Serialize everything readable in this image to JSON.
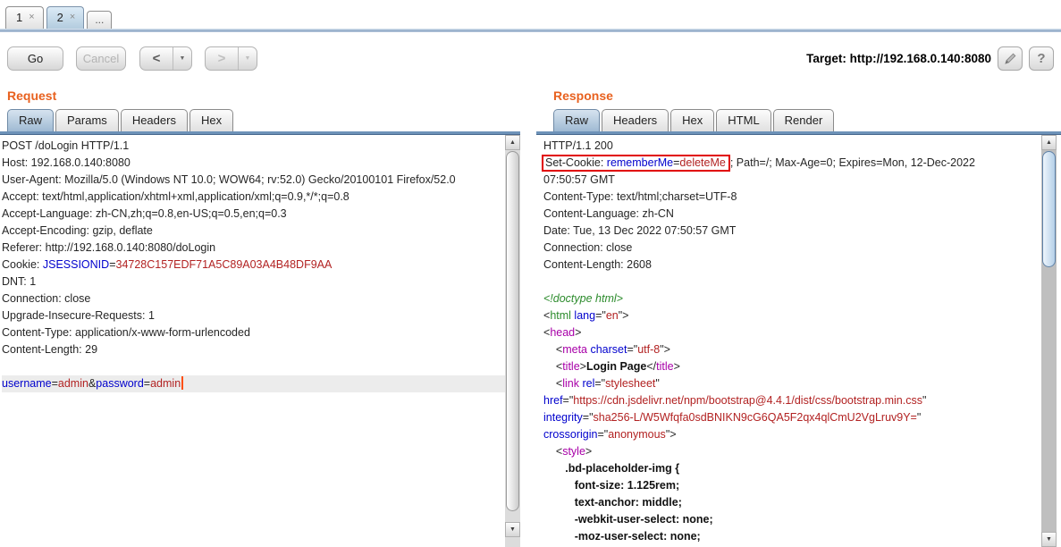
{
  "session_tabs": [
    {
      "label": "1",
      "close": "×",
      "selected": false,
      "mini": false
    },
    {
      "label": "2",
      "close": "×",
      "selected": true,
      "mini": false
    },
    {
      "label": "...",
      "close": "",
      "selected": false,
      "mini": true
    }
  ],
  "toolbar": {
    "go": "Go",
    "cancel": "Cancel",
    "back_icon": "<",
    "forward_icon": ">",
    "dropdown_icon": "▼",
    "target_label": "Target:",
    "target_url": "http://192.168.0.140:8080",
    "help_icon": "?"
  },
  "scrollbar": {
    "up_icon": "▲",
    "down_icon": "▼"
  },
  "colors": {
    "accent_orange": "#e8611f",
    "syntax_key_blue": "#0101cd",
    "syntax_value_red": "#b22222",
    "syntax_tag_magenta": "#a800a8",
    "syntax_green": "#2c8b2c",
    "highlight_box_red": "#e10000",
    "selected_tab_blue": "#b3ccdf"
  },
  "request": {
    "title": "Request",
    "tabs": [
      {
        "label": "Raw",
        "selected": true
      },
      {
        "label": "Params",
        "selected": false
      },
      {
        "label": "Headers",
        "selected": false
      },
      {
        "label": "Hex",
        "selected": false
      }
    ],
    "lines": [
      {
        "parts": [
          {
            "t": "POST /doLogin HTTP/1.1"
          }
        ]
      },
      {
        "parts": [
          {
            "t": "Host: 192.168.0.140:8080"
          }
        ]
      },
      {
        "parts": [
          {
            "t": "User-Agent: Mozilla/5.0 (Windows NT 10.0; WOW64; rv:52.0) Gecko/20100101 Firefox/52.0"
          }
        ]
      },
      {
        "parts": [
          {
            "t": "Accept: text/html,application/xhtml+xml,application/xml;q=0.9,*/*;q=0.8"
          }
        ]
      },
      {
        "parts": [
          {
            "t": "Accept-Language: zh-CN,zh;q=0.8,en-US;q=0.5,en;q=0.3"
          }
        ]
      },
      {
        "parts": [
          {
            "t": "Accept-Encoding: gzip, deflate"
          }
        ]
      },
      {
        "parts": [
          {
            "t": "Referer: http://192.168.0.140:8080/doLogin"
          }
        ]
      },
      {
        "parts": [
          {
            "t": "Cookie: "
          },
          {
            "t": "JSESSIONID",
            "c": "k"
          },
          {
            "t": "="
          },
          {
            "t": "34728C157EDF71A5C89A03A4B48DF9AA",
            "c": "v"
          }
        ]
      },
      {
        "parts": [
          {
            "t": "DNT: 1"
          }
        ]
      },
      {
        "parts": [
          {
            "t": "Connection: close"
          }
        ]
      },
      {
        "parts": [
          {
            "t": "Upgrade-Insecure-Requests: 1"
          }
        ]
      },
      {
        "parts": [
          {
            "t": "Content-Type: application/x-www-form-urlencoded"
          }
        ]
      },
      {
        "parts": [
          {
            "t": "Content-Length: 29"
          }
        ]
      },
      {
        "parts": []
      },
      {
        "hl": true,
        "cursor": true,
        "parts": [
          {
            "t": "username",
            "c": "k"
          },
          {
            "t": "="
          },
          {
            "t": "admin",
            "c": "v"
          },
          {
            "t": "&"
          },
          {
            "t": "password",
            "c": "k"
          },
          {
            "t": "="
          },
          {
            "t": "admin",
            "c": "v"
          }
        ]
      }
    ]
  },
  "response": {
    "title": "Response",
    "tabs": [
      {
        "label": "Raw",
        "selected": true
      },
      {
        "label": "Headers",
        "selected": false
      },
      {
        "label": "Hex",
        "selected": false
      },
      {
        "label": "HTML",
        "selected": false
      },
      {
        "label": "Render",
        "selected": false
      }
    ],
    "lines": [
      {
        "parts": [
          {
            "t": "HTTP/1.1 200"
          }
        ]
      },
      {
        "parts": [
          {
            "t": "Set-Cookie: ",
            "x": 1
          },
          {
            "t": "rememberMe",
            "c": "k",
            "x": 1
          },
          {
            "t": "=",
            "x": 1
          },
          {
            "t": "deleteMe",
            "c": "v",
            "x": 1
          },
          {
            "t": "; Path=/; Max-Age=0; Expires=Mon, 12-Dec-2022"
          }
        ]
      },
      {
        "parts": [
          {
            "t": "07:50:57 GMT"
          }
        ]
      },
      {
        "parts": [
          {
            "t": "Content-Type: text/html;charset=UTF-8"
          }
        ]
      },
      {
        "parts": [
          {
            "t": "Content-Language: zh-CN"
          }
        ]
      },
      {
        "parts": [
          {
            "t": "Date: Tue, 13 Dec 2022 07:50:57 GMT"
          }
        ]
      },
      {
        "parts": [
          {
            "t": "Connection: close"
          }
        ]
      },
      {
        "parts": [
          {
            "t": "Content-Length: 2608"
          }
        ]
      },
      {
        "parts": []
      },
      {
        "parts": [
          {
            "t": "<!doctype html>",
            "c": "d"
          }
        ]
      },
      {
        "parts": [
          {
            "t": "<"
          },
          {
            "t": "html",
            "c": "g"
          },
          {
            "t": " "
          },
          {
            "t": "lang",
            "c": "k"
          },
          {
            "t": "=\""
          },
          {
            "t": "en",
            "c": "v"
          },
          {
            "t": "\">"
          }
        ]
      },
      {
        "parts": [
          {
            "t": "<"
          },
          {
            "t": "head",
            "c": "m"
          },
          {
            "t": ">"
          }
        ]
      },
      {
        "parts": [
          {
            "t": "    <"
          },
          {
            "t": "meta",
            "c": "m"
          },
          {
            "t": " "
          },
          {
            "t": "charset",
            "c": "k"
          },
          {
            "t": "=\""
          },
          {
            "t": "utf-8",
            "c": "v"
          },
          {
            "t": "\">"
          }
        ]
      },
      {
        "parts": [
          {
            "t": "    <"
          },
          {
            "t": "title",
            "c": "m"
          },
          {
            "t": ">"
          },
          {
            "t": "Login Page",
            "c": "b"
          },
          {
            "t": "</"
          },
          {
            "t": "title",
            "c": "m"
          },
          {
            "t": ">"
          }
        ]
      },
      {
        "parts": [
          {
            "t": "    <"
          },
          {
            "t": "link",
            "c": "m"
          },
          {
            "t": " "
          },
          {
            "t": "rel",
            "c": "k"
          },
          {
            "t": "=\""
          },
          {
            "t": "stylesheet",
            "c": "v"
          },
          {
            "t": "\""
          }
        ]
      },
      {
        "parts": [
          {
            "t": "href",
            "c": "k"
          },
          {
            "t": "=\""
          },
          {
            "t": "https://cdn.jsdelivr.net/npm/bootstrap@4.4.1/dist/css/bootstrap.min.css",
            "c": "v"
          },
          {
            "t": "\""
          }
        ]
      },
      {
        "parts": [
          {
            "t": "integrity",
            "c": "k"
          },
          {
            "t": "=\""
          },
          {
            "t": "sha256-L/W5Wfqfa0sdBNIKN9cG6QA5F2qx4qlCmU2VgLruv9Y=",
            "c": "v"
          },
          {
            "t": "\""
          }
        ]
      },
      {
        "parts": [
          {
            "t": "crossorigin",
            "c": "k"
          },
          {
            "t": "=\""
          },
          {
            "t": "anonymous",
            "c": "v"
          },
          {
            "t": "\">"
          }
        ]
      },
      {
        "parts": [
          {
            "t": "    <"
          },
          {
            "t": "style",
            "c": "m"
          },
          {
            "t": ">"
          }
        ]
      },
      {
        "parts": [
          {
            "t": "       .bd-placeholder-img {",
            "c": "b"
          }
        ]
      },
      {
        "parts": [
          {
            "t": "          font-size: 1.125rem;",
            "c": "b"
          }
        ]
      },
      {
        "parts": [
          {
            "t": "          text-anchor: middle;",
            "c": "b"
          }
        ]
      },
      {
        "parts": [
          {
            "t": "          -webkit-user-select: none;",
            "c": "b"
          }
        ]
      },
      {
        "parts": [
          {
            "t": "          -moz-user-select: none;",
            "c": "b"
          }
        ]
      }
    ]
  }
}
